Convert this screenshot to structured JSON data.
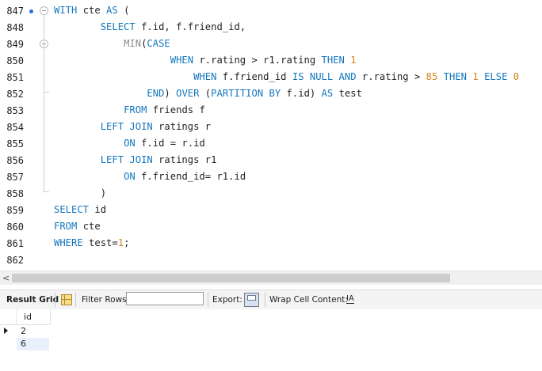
{
  "editor": {
    "lines": [
      {
        "num": "847",
        "marker": true,
        "fold": true,
        "tokens": [
          [
            "kw",
            "WITH"
          ],
          [
            "tx",
            " cte "
          ],
          [
            "kw",
            "AS"
          ],
          [
            "tx",
            " ("
          ]
        ]
      },
      {
        "num": "848",
        "tokens": [
          [
            "tx",
            "        "
          ],
          [
            "kw",
            "SELECT"
          ],
          [
            "tx",
            " f.id, f.friend_id,"
          ]
        ]
      },
      {
        "num": "849",
        "fold": true,
        "tokens": [
          [
            "tx",
            "            "
          ],
          [
            "fn",
            "MIN"
          ],
          [
            "tx",
            "("
          ],
          [
            "kw",
            "CASE"
          ]
        ]
      },
      {
        "num": "850",
        "tokens": [
          [
            "tx",
            "                    "
          ],
          [
            "kw",
            "WHEN"
          ],
          [
            "tx",
            " r.rating > r1.rating "
          ],
          [
            "kw",
            "THEN"
          ],
          [
            "tx",
            " "
          ],
          [
            "num",
            "1"
          ]
        ]
      },
      {
        "num": "851",
        "tokens": [
          [
            "tx",
            "                        "
          ],
          [
            "kw",
            "WHEN"
          ],
          [
            "tx",
            " f.friend_id "
          ],
          [
            "kw",
            "IS NULL AND"
          ],
          [
            "tx",
            " r.rating > "
          ],
          [
            "num",
            "85"
          ],
          [
            "tx",
            " "
          ],
          [
            "kw",
            "THEN"
          ],
          [
            "tx",
            " "
          ],
          [
            "num",
            "1"
          ],
          [
            "tx",
            " "
          ],
          [
            "kw",
            "ELSE"
          ],
          [
            "tx",
            " "
          ],
          [
            "num",
            "0"
          ]
        ]
      },
      {
        "num": "852",
        "foldend": true,
        "tokens": [
          [
            "tx",
            "                "
          ],
          [
            "kw",
            "END"
          ],
          [
            "tx",
            ") "
          ],
          [
            "kw",
            "OVER"
          ],
          [
            "tx",
            " ("
          ],
          [
            "kw",
            "PARTITION BY"
          ],
          [
            "tx",
            " f.id) "
          ],
          [
            "kw",
            "AS"
          ],
          [
            "tx",
            " test"
          ]
        ]
      },
      {
        "num": "853",
        "tokens": [
          [
            "tx",
            "            "
          ],
          [
            "kw",
            "FROM"
          ],
          [
            "tx",
            " friends f"
          ]
        ]
      },
      {
        "num": "854",
        "tokens": [
          [
            "tx",
            "        "
          ],
          [
            "kw",
            "LEFT JOIN"
          ],
          [
            "tx",
            " ratings r"
          ]
        ]
      },
      {
        "num": "855",
        "tokens": [
          [
            "tx",
            "            "
          ],
          [
            "kw",
            "ON"
          ],
          [
            "tx",
            " f.id = r.id"
          ]
        ]
      },
      {
        "num": "856",
        "tokens": [
          [
            "tx",
            "        "
          ],
          [
            "kw",
            "LEFT JOIN"
          ],
          [
            "tx",
            " ratings r1"
          ]
        ]
      },
      {
        "num": "857",
        "tokens": [
          [
            "tx",
            "            "
          ],
          [
            "kw",
            "ON"
          ],
          [
            "tx",
            " f.friend_id= r1.id"
          ]
        ]
      },
      {
        "num": "858",
        "foldend": true,
        "tokens": [
          [
            "tx",
            "        )"
          ]
        ]
      },
      {
        "num": "859",
        "tokens": [
          [
            "kw",
            "SELECT"
          ],
          [
            "tx",
            " id"
          ]
        ]
      },
      {
        "num": "860",
        "tokens": [
          [
            "kw",
            "FROM"
          ],
          [
            "tx",
            " cte"
          ]
        ]
      },
      {
        "num": "861",
        "tokens": [
          [
            "kw",
            "WHERE"
          ],
          [
            "tx",
            " test="
          ],
          [
            "num",
            "1"
          ],
          [
            "tx",
            ";"
          ]
        ]
      },
      {
        "num": "862",
        "tokens": []
      }
    ]
  },
  "scrollbar": {
    "left_arrow": "<"
  },
  "toolbar": {
    "result_grid": "Result Grid",
    "filter_rows": "Filter Rows:",
    "filter_value": "",
    "export": "Export:",
    "wrap_cell": "Wrap Cell Content:",
    "wrap_icon": "IA"
  },
  "result": {
    "columns": [
      "id"
    ],
    "rows": [
      [
        "2"
      ],
      [
        "6"
      ]
    ]
  },
  "colors": {
    "keyword": "#1478bf",
    "number": "#d2851c",
    "function": "#8c8c8c"
  }
}
